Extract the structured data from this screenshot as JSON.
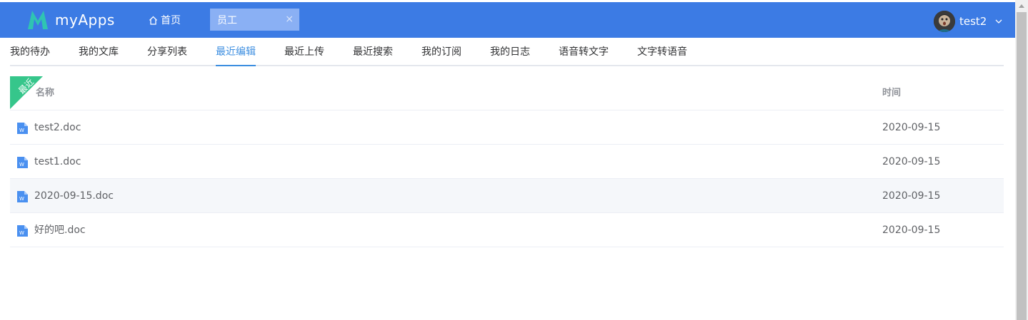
{
  "header": {
    "app_name": "myApps",
    "home_label": "首页",
    "open_tab_label": "员工",
    "close_glyph": "×",
    "username": "test2",
    "icons": [
      "logo-m-icon",
      "home-icon",
      "close-icon",
      "avatar",
      "chevron-down-icon"
    ],
    "brand_color": "#3c7be4"
  },
  "nav": {
    "items": [
      "我的待办",
      "我的文库",
      "分享列表",
      "最近编辑",
      "最近上传",
      "最近搜索",
      "我的订阅",
      "我的日志",
      "语音转文字",
      "文字转语音"
    ],
    "active_index": 3,
    "active_color": "#3c8ee0"
  },
  "table": {
    "ribbon_label": "最近",
    "ribbon_color": "#36c68b",
    "columns": {
      "name": "名称",
      "time": "时间"
    },
    "rows": [
      {
        "name": "test2.doc",
        "time": "2020-09-15"
      },
      {
        "name": "test1.doc",
        "time": "2020-09-15"
      },
      {
        "name": "2020-09-15.doc",
        "time": "2020-09-15"
      },
      {
        "name": "好的吧.doc",
        "time": "2020-09-15"
      }
    ],
    "file_icon": "word-doc-icon"
  }
}
